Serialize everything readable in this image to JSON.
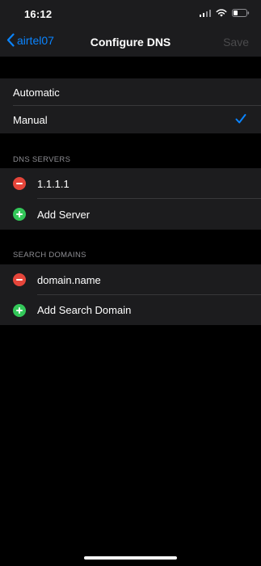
{
  "status_bar": {
    "time": "16:12"
  },
  "nav": {
    "back_label": "airtel07",
    "title": "Configure DNS",
    "save_label": "Save"
  },
  "mode": {
    "options": [
      "Automatic",
      "Manual"
    ],
    "selected": "Manual"
  },
  "dns_servers": {
    "header": "DNS SERVERS",
    "entries": [
      "1.1.1.1"
    ],
    "add_label": "Add Server"
  },
  "search_domains": {
    "header": "SEARCH DOMAINS",
    "entries": [
      "domain.name"
    ],
    "add_label": "Add Search Domain"
  },
  "colors": {
    "accent": "#0a84ff",
    "delete": "#e5453a",
    "add": "#33c759",
    "cell": "#1c1c1e",
    "background": "#000000"
  }
}
